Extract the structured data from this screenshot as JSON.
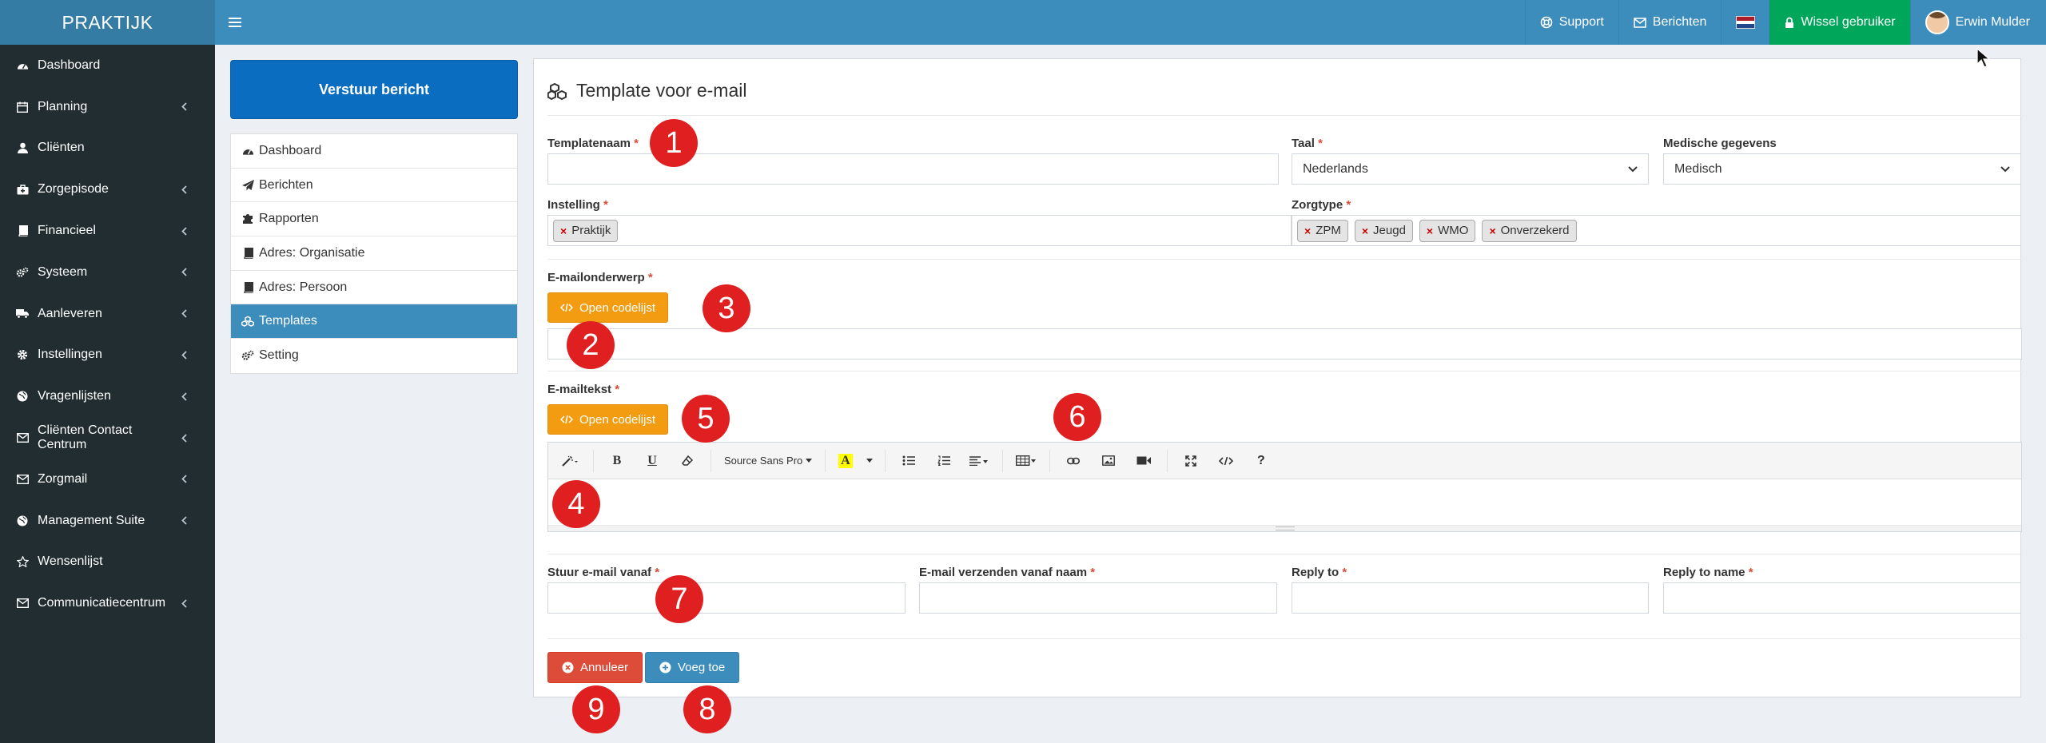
{
  "app": {
    "brand": "PRAKTIJK"
  },
  "topnav": {
    "support": "Support",
    "messages": "Berichten",
    "switch_user": "Wissel gebruiker",
    "user": "Erwin Mulder"
  },
  "sidebar": {
    "items": [
      {
        "label": "Dashboard",
        "icon": "dashboard-icon",
        "chevron": false
      },
      {
        "label": "Planning",
        "icon": "calendar-icon",
        "chevron": true
      },
      {
        "label": "Cliënten",
        "icon": "user-icon",
        "chevron": false
      },
      {
        "label": "Zorgepisode",
        "icon": "medkit-icon",
        "chevron": true
      },
      {
        "label": "Financieel",
        "icon": "book-icon",
        "chevron": true
      },
      {
        "label": "Systeem",
        "icon": "cogs-icon",
        "chevron": true
      },
      {
        "label": "Aanleveren",
        "icon": "truck-icon",
        "chevron": true
      },
      {
        "label": "Instellingen",
        "icon": "gear-icon",
        "chevron": true
      },
      {
        "label": "Vragenlijsten",
        "icon": "globe-icon",
        "chevron": true
      },
      {
        "label": "Cliënten Contact Centrum",
        "icon": "envelope-icon",
        "chevron": true
      },
      {
        "label": "Zorgmail",
        "icon": "envelope-icon",
        "chevron": true
      },
      {
        "label": "Management Suite",
        "icon": "globe-icon",
        "chevron": true
      },
      {
        "label": "Wensenlijst",
        "icon": "star-icon",
        "chevron": false
      },
      {
        "label": "Communicatiecentrum",
        "icon": "envelope-icon",
        "chevron": true
      }
    ]
  },
  "leftpanel": {
    "send_button": "Verstuur bericht",
    "menu": [
      {
        "label": "Dashboard",
        "icon": "dashboard-icon",
        "active": false
      },
      {
        "label": "Berichten",
        "icon": "paper-plane-icon",
        "active": false
      },
      {
        "label": "Rapporten",
        "icon": "puzzle-icon",
        "active": false
      },
      {
        "label": "Adres: Organisatie",
        "icon": "book-icon",
        "active": false
      },
      {
        "label": "Adres: Persoon",
        "icon": "book-icon",
        "active": false
      },
      {
        "label": "Templates",
        "icon": "cubes-icon",
        "active": true
      },
      {
        "label": "Setting",
        "icon": "cogs-icon",
        "active": false
      }
    ]
  },
  "form": {
    "title": "Template voor e-mail",
    "templatenaam_label": "Templatenaam",
    "taal_label": "Taal",
    "taal_value": "Nederlands",
    "medisch_label": "Medische gegevens",
    "medisch_value": "Medisch",
    "instelling_label": "Instelling",
    "instelling_tags": [
      "Praktijk"
    ],
    "zorgtype_label": "Zorgtype",
    "zorgtype_tags": [
      "ZPM",
      "Jeugd",
      "WMO",
      "Onverzekerd"
    ],
    "subject_label": "E-mailonderwerp",
    "codelist_button": "Open codelijst",
    "body_label": "E-mailtekst",
    "font_name": "Source Sans Pro",
    "from_label": "Stuur e-mail vanaf",
    "from_name_label": "E-mail verzenden vanaf naam",
    "reply_to_label": "Reply to",
    "reply_to_name_label": "Reply to name",
    "required_mark": "*",
    "cancel_button": "Annuleer",
    "add_button": "Voeg toe"
  },
  "annotations": [
    "1",
    "2",
    "3",
    "4",
    "5",
    "6",
    "7",
    "8",
    "9"
  ],
  "colors": {
    "header": "#3c8dbc",
    "brand": "#357ca5",
    "sidebar": "#222d32",
    "primary": "#0b6dbf",
    "warning": "#f39c12",
    "danger": "#dd4b39",
    "success": "#00a65a",
    "badge": "#e02020"
  }
}
